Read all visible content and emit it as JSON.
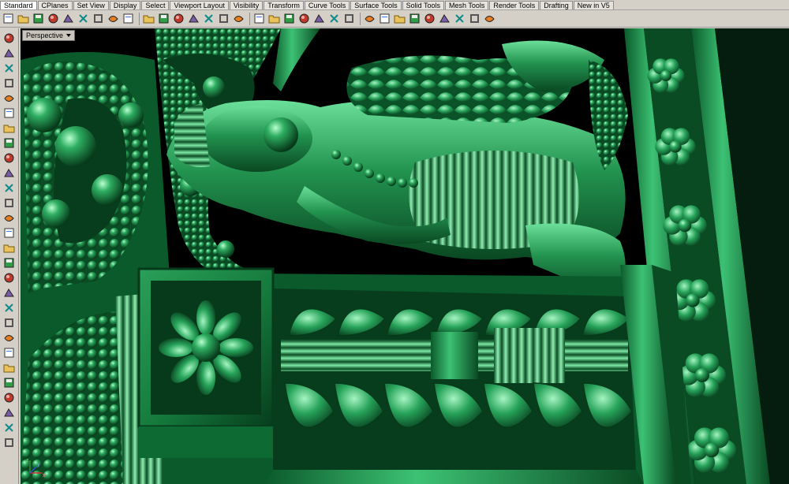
{
  "tabs": [
    {
      "label": "Standard",
      "active": true
    },
    {
      "label": "CPlanes"
    },
    {
      "label": "Set View"
    },
    {
      "label": "Display"
    },
    {
      "label": "Select"
    },
    {
      "label": "Viewport Layout"
    },
    {
      "label": "Visibility"
    },
    {
      "label": "Transform"
    },
    {
      "label": "Curve Tools"
    },
    {
      "label": "Surface Tools"
    },
    {
      "label": "Solid Tools"
    },
    {
      "label": "Mesh Tools"
    },
    {
      "label": "Render Tools"
    },
    {
      "label": "Drafting"
    },
    {
      "label": "New in V5"
    }
  ],
  "toolbar_icons": [
    "new-file-icon",
    "open-folder-icon",
    "save-icon",
    "print-icon",
    "import-icon",
    "cut-icon",
    "copy-icon",
    "paste-icon",
    "undo-icon",
    "pan-hand-icon",
    "rotate-view-icon",
    "zoom-icon",
    "zoom-window-icon",
    "zoom-extents-icon",
    "zoom-selected-icon",
    "undo-view-icon",
    "four-viewports-icon",
    "cplane-icon",
    "grid-snap-icon",
    "points-on-icon",
    "select-icon",
    "wireframe-icon",
    "shaded-icon",
    "render-icon",
    "color-wheel-icon",
    "material-sphere-icon",
    "render-sphere-icon",
    "env-sphere-icon",
    "sun-icon",
    "layer-icon",
    "options-icon",
    "help-icon"
  ],
  "left_tools": [
    "point-icon",
    "polyline-icon",
    "curve-icon",
    "circle-icon",
    "arc-icon",
    "ellipse-icon",
    "polygon-icon",
    "rectangle-icon",
    "fillet-curve-icon",
    "offset-icon",
    "surface-icon",
    "extrude-icon",
    "solid-box-icon",
    "sphere-icon",
    "cylinder-icon",
    "boolean-icon",
    "mesh-icon",
    "transform-icon",
    "move-icon",
    "join-icon",
    "explode-icon",
    "trim-icon",
    "split-icon",
    "text-icon",
    "dimension-icon",
    "array-icon",
    "group-icon",
    "lock-icon"
  ],
  "viewport": {
    "title": "Perspective",
    "axes": {
      "x": "x",
      "y": "y",
      "z": "z"
    }
  },
  "colors": {
    "chrome": "#d4d0c8",
    "viewport_bg": "#000000",
    "model_green": "#1f8a4c",
    "model_highlight": "#9ff0b8",
    "model_shadow": "#083a1c"
  }
}
